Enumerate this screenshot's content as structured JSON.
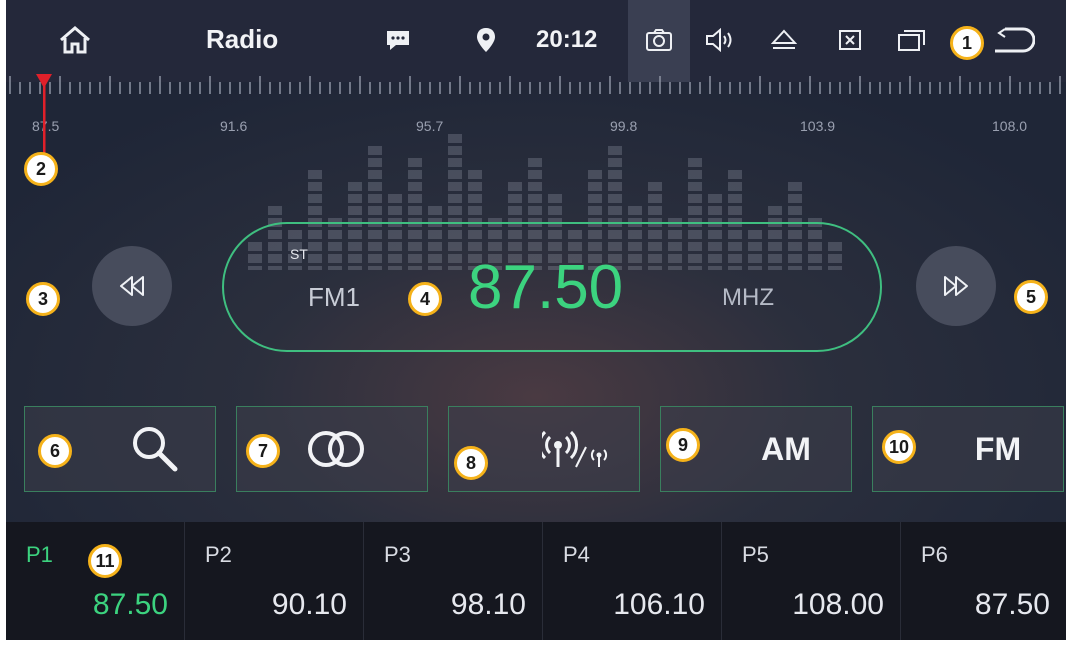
{
  "topbar": {
    "title": "Radio",
    "time": "20:12"
  },
  "scale": {
    "labels": [
      "87.5",
      "91.6",
      "95.7",
      "99.8",
      "103.9",
      "108.0"
    ]
  },
  "display": {
    "stereo": "ST",
    "band": "FM1",
    "frequency": "87.50",
    "unit": "MHZ"
  },
  "controls": {
    "am_label": "AM",
    "fm_label": "FM"
  },
  "presets": [
    {
      "name": "P1",
      "value": "87.50"
    },
    {
      "name": "P2",
      "value": "90.10"
    },
    {
      "name": "P3",
      "value": "98.10"
    },
    {
      "name": "P4",
      "value": "106.10"
    },
    {
      "name": "P5",
      "value": "108.00"
    },
    {
      "name": "P6",
      "value": "87.50"
    }
  ],
  "badges": [
    "1",
    "2",
    "3",
    "4",
    "5",
    "6",
    "7",
    "8",
    "9",
    "10",
    "11"
  ],
  "colors": {
    "accent": "#3cd37f",
    "badge": "#f5b21a",
    "needle": "#e0202a"
  }
}
